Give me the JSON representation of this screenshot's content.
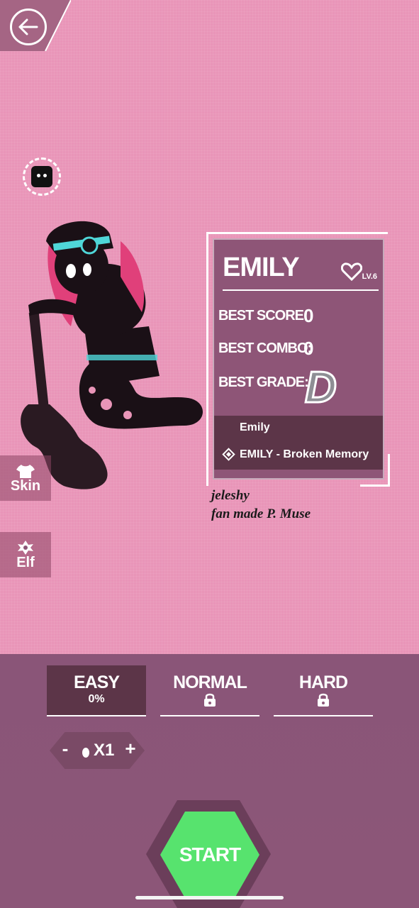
{
  "character": {
    "name": "EMILY",
    "level": "LV.6"
  },
  "stats": {
    "best_score_label": "BEST SCORE:",
    "best_score_value": "0",
    "best_combo_label": "BEST COMBO:",
    "best_combo_value": "0",
    "best_grade_label": "BEST GRADE:",
    "best_grade_value": "D"
  },
  "song_list": {
    "artist": "Emily",
    "selected_song": "EMILY - Broken Memory"
  },
  "credit": {
    "line1": "jeleshy",
    "line2": "fan made P. Muse"
  },
  "side_menu": {
    "skin_label": "Skin",
    "elf_label": "Elf"
  },
  "difficulty": {
    "tabs": [
      {
        "label": "EASY",
        "sub": "0%",
        "state": "selected"
      },
      {
        "label": "NORMAL",
        "state": "locked"
      },
      {
        "label": "HARD",
        "state": "locked"
      }
    ]
  },
  "speed": {
    "minus": "-",
    "plus": "+",
    "value": "X1"
  },
  "start_label": "START",
  "colors": {
    "background": "#e995b8",
    "panel": "#8c5678",
    "start": "#57e36e",
    "accent_cyan": "#4fd6d8"
  }
}
